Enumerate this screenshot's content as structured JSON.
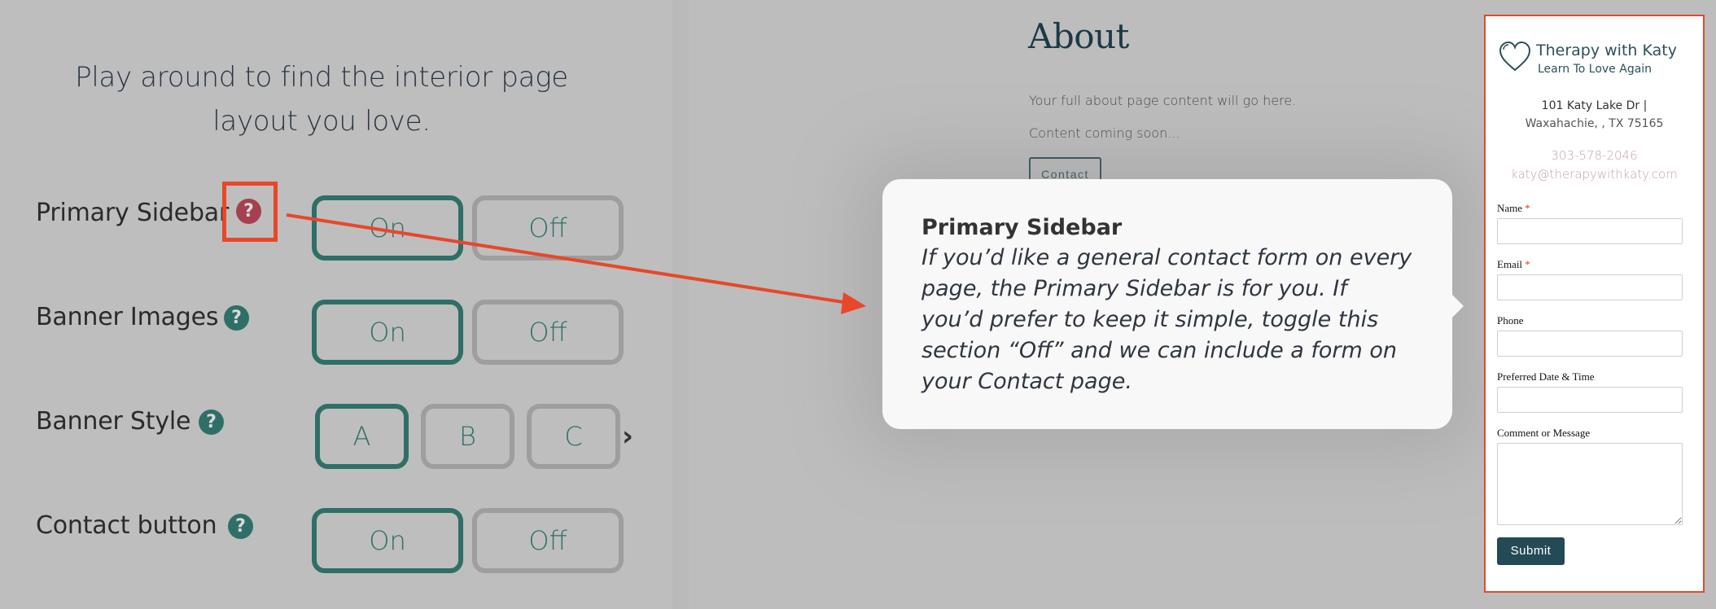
{
  "configurator": {
    "intro": "Play around to find the interior page layout you love.",
    "rows": [
      {
        "label": "Primary Sidebar",
        "help": "?",
        "options": [
          "On",
          "Off"
        ],
        "selected": "On"
      },
      {
        "label": "Banner Images",
        "help": "?",
        "options": [
          "On",
          "Off"
        ],
        "selected": "On"
      },
      {
        "label": "Banner Style",
        "help": "?",
        "options": [
          "A",
          "B",
          "C"
        ],
        "selected": "A",
        "more_icon": "chevron-right-icon"
      },
      {
        "label": "Contact button",
        "help": "?",
        "options": [
          "On",
          "Off"
        ],
        "selected": "On"
      }
    ]
  },
  "preview": {
    "title": "About",
    "paragraphs": [
      "Your full about page content will go here.",
      "Content coming soon..."
    ],
    "contact_button": "Contact"
  },
  "tooltip": {
    "title": "Primary Sidebar",
    "body": "If you’d like a general contact form on every page, the Primary Sidebar is for you. If you’d prefer to keep it simple, toggle this section “Off” and we can include a form on your Contact page."
  },
  "sidebar": {
    "brand_name": "Therapy with Katy",
    "tagline": "Learn To Love Again",
    "address_line1": "101 Katy Lake Dr |",
    "address_line2": "Waxahachie, , TX 75165",
    "phone": "303-578-2046",
    "email": "katy@therapywithkaty.com",
    "form": {
      "fields": [
        {
          "label": "Name",
          "required": "*",
          "value": ""
        },
        {
          "label": "Email",
          "required": "*",
          "value": ""
        },
        {
          "label": "Phone",
          "required": "",
          "value": ""
        },
        {
          "label": "Preferred Date & Time",
          "required": "",
          "value": ""
        },
        {
          "label": "Comment or Message",
          "required": "",
          "value": ""
        }
      ],
      "submit": "Submit"
    }
  },
  "colors": {
    "accent_teal": "#2f6f68",
    "active_help": "#a5404f",
    "annotation_red": "#e8472b",
    "submit_bg": "#234a56"
  }
}
